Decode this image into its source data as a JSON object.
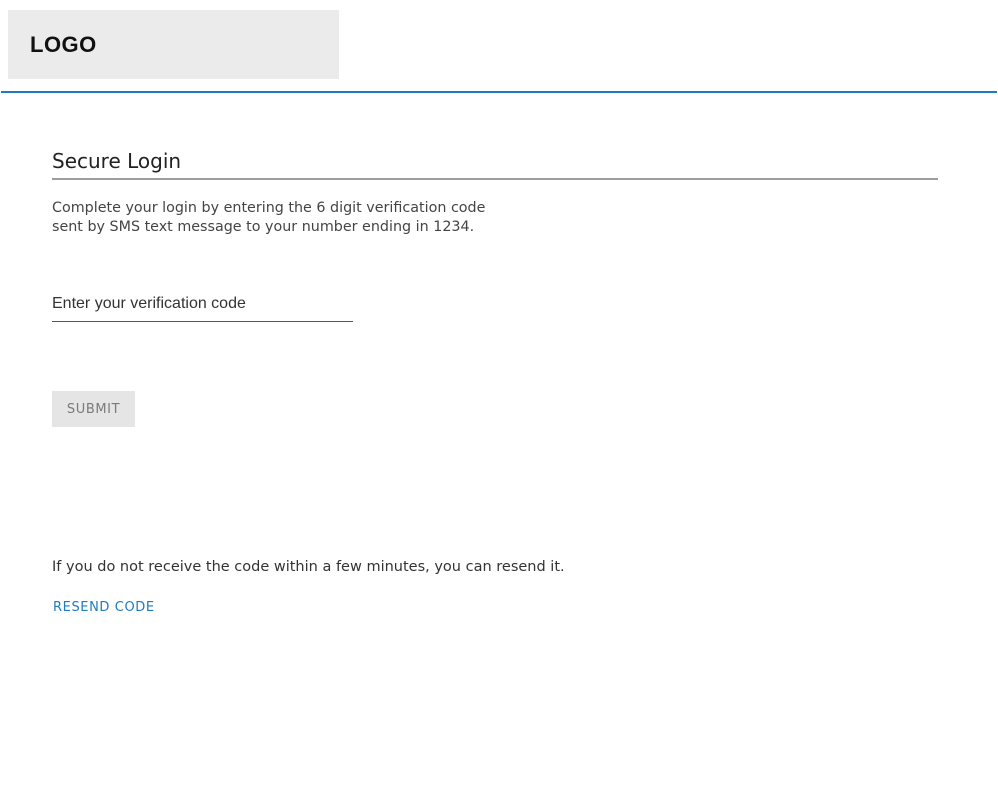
{
  "header": {
    "logo_text": "LOGO",
    "accent_color": "#1f7bbd"
  },
  "main": {
    "title": "Secure Login",
    "instructions": "Complete your login by entering the 6 digit verification code sent by SMS text message to your number ending in 1234.",
    "code_input": {
      "placeholder": "Enter your verification code",
      "value": ""
    },
    "submit_label": "SUBMIT",
    "resend_note": "If you do not receive the code within a few minutes, you can resend it.",
    "resend_label": "RESEND CODE"
  }
}
